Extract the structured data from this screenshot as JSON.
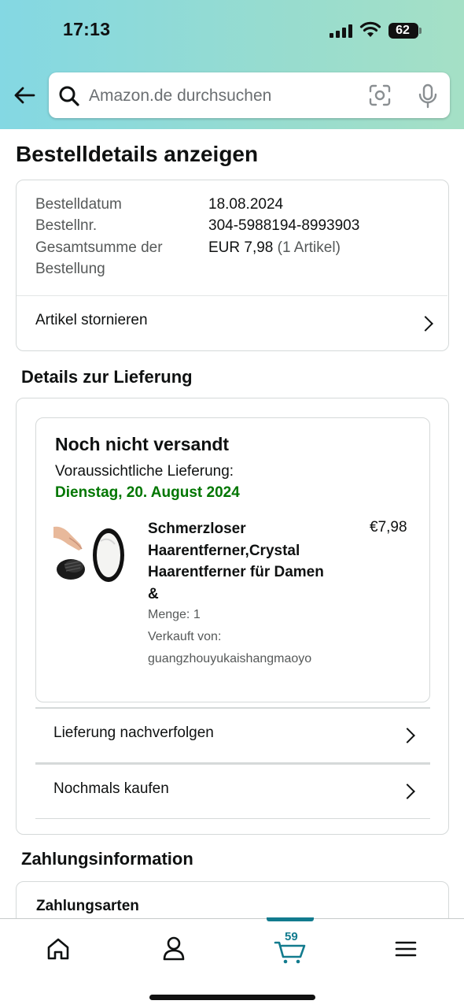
{
  "status_bar": {
    "time": "17:13",
    "battery": "62"
  },
  "header": {
    "search_placeholder": "Amazon.de durchsuchen"
  },
  "page": {
    "title": "Bestelldetails anzeigen"
  },
  "order_summary": {
    "date_label": "Bestelldatum",
    "date_value": "18.08.2024",
    "number_label": "Bestellnr.",
    "number_value": "304-5988194-8993903",
    "total_label_line1": "Gesamtsumme der",
    "total_label_line2": "Bestellung",
    "total_value": "EUR 7,98",
    "total_items": "(1 Artikel)",
    "cancel_label": "Artikel stornieren"
  },
  "delivery": {
    "section_title": "Details zur Lieferung",
    "status": "Noch nicht versandt",
    "eta_label": "Voraussichtliche Lieferung:",
    "eta_date": "Dienstag, 20. August 2024",
    "product": {
      "title": "Schmerzloser Haarentferner,Crystal Haarentferner für Damen &",
      "price": "€7,98",
      "quantity": "Menge: 1",
      "sold_by_label": "Verkauft von:",
      "seller": "guangzhouyukaishangmaoyo"
    },
    "track_label": "Lieferung nachverfolgen",
    "buy_again_label": "Nochmals kaufen"
  },
  "payment": {
    "section_title": "Zahlungsinformation",
    "methods_label": "Zahlungsarten"
  },
  "bottom_nav": {
    "cart_count": "59"
  },
  "colors": {
    "header_gradient_start": "#84d8e3",
    "header_gradient_end": "#a5e0c6",
    "delivery_green": "#007600",
    "cart_accent": "#127b8e",
    "border": "#d5d9d9"
  }
}
